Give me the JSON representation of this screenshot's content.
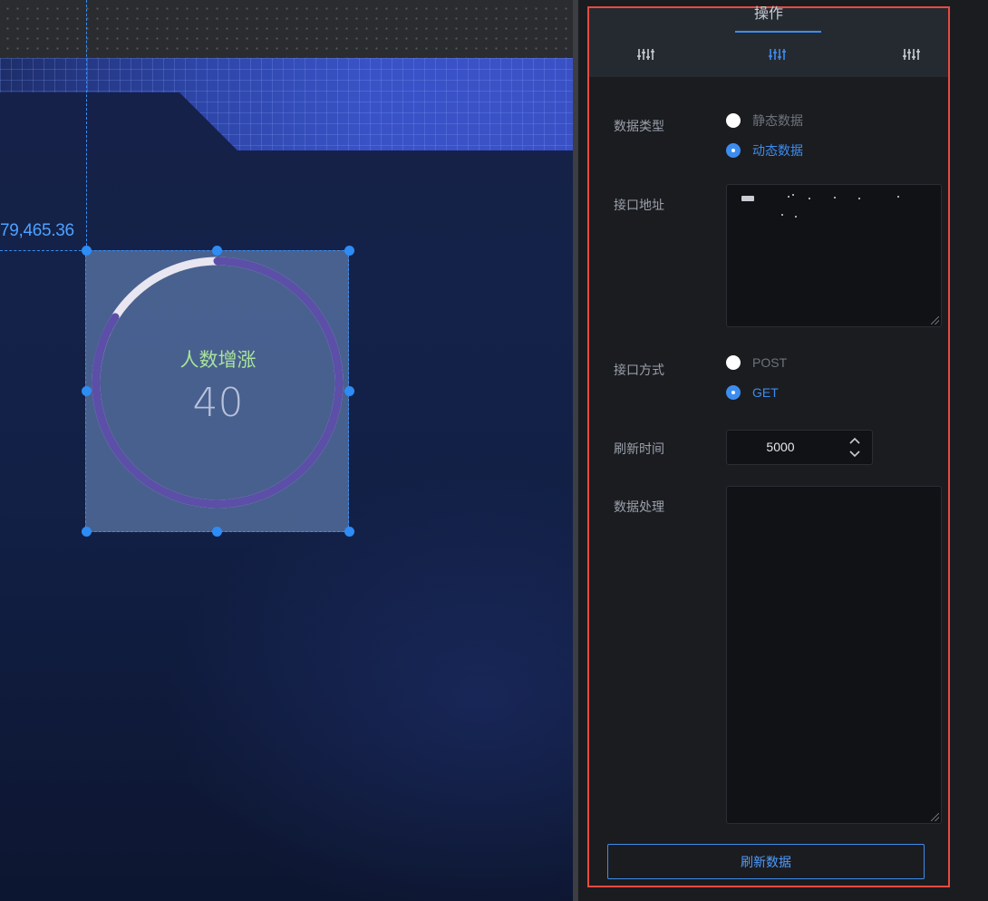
{
  "canvas": {
    "coord_label": "79,465.36",
    "widget": {
      "title": "人数增涨",
      "value": "40",
      "progress_percent": 84,
      "colors": {
        "track": "#e8e6f0",
        "progress": "#5b4fa8",
        "title": "#a8e39a",
        "value": "#b9c2dc"
      }
    }
  },
  "panel": {
    "header": {
      "title": "操作",
      "tabs": [
        {
          "icon": "sliders-icon",
          "active": false
        },
        {
          "icon": "sliders-icon",
          "active": true
        },
        {
          "icon": "sliders-icon",
          "active": false
        }
      ]
    },
    "form": {
      "data_type": {
        "label": "数据类型",
        "options": [
          {
            "label": "静态数据",
            "selected": false
          },
          {
            "label": "动态数据",
            "selected": true
          }
        ]
      },
      "api_url": {
        "label": "接口地址",
        "value": ""
      },
      "api_method": {
        "label": "接口方式",
        "options": [
          {
            "label": "POST",
            "selected": false
          },
          {
            "label": "GET",
            "selected": true
          }
        ]
      },
      "refresh_time": {
        "label": "刷新时间",
        "value": "5000"
      },
      "data_processing": {
        "label": "数据处理",
        "value": ""
      }
    },
    "refresh_button": "刷新数据",
    "accent_color": "#3d8cf0",
    "highlight_border_color": "#e54b41"
  }
}
